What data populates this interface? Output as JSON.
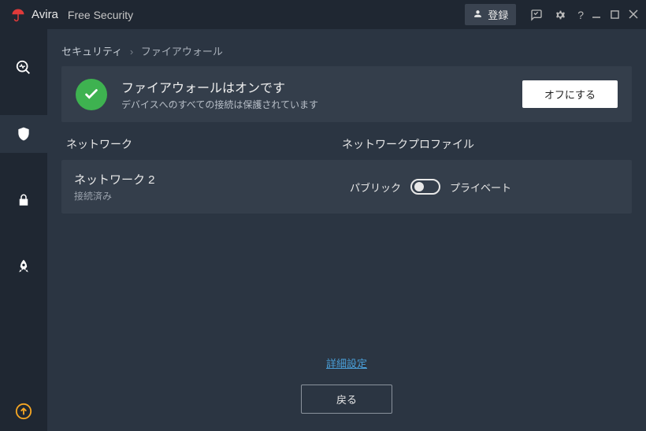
{
  "titlebar": {
    "brand": "Avira",
    "product": "Free Security",
    "signin_label": "登録"
  },
  "breadcrumb": {
    "root": "セキュリティ",
    "current": "ファイアウォール"
  },
  "status": {
    "title": "ファイアウォールはオンです",
    "subtitle": "デバイスへのすべての接続は保護されています",
    "off_button": "オフにする"
  },
  "columns": {
    "network": "ネットワーク",
    "profile": "ネットワークプロファイル"
  },
  "network": {
    "name": "ネットワーク 2",
    "state": "接続済み",
    "profile_public": "パブリック",
    "profile_private": "プライベート"
  },
  "footer": {
    "advanced_link": "詳細設定",
    "back_button": "戻る"
  }
}
